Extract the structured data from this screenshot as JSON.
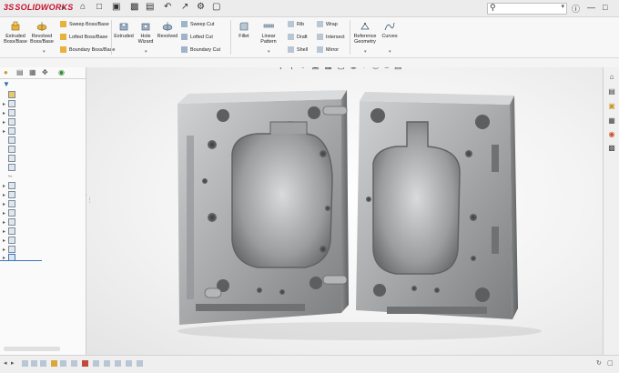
{
  "app": {
    "brand": "SOLIDWORKS",
    "brand_prefix": "3S"
  },
  "search": {
    "placeholder": ""
  },
  "ribbon": {
    "commands": [
      {
        "id": "extruded-boss",
        "label_line1": "Extruded",
        "label_line2": "Boss/Base"
      },
      {
        "id": "revolved-boss",
        "label_line1": "Revolved",
        "label_line2": "Boss/Base"
      },
      {
        "id": "sweep-boss",
        "label": "Sweep Boss/Base"
      },
      {
        "id": "lofted-boss",
        "label": "Lofted Boss/Base"
      },
      {
        "id": "boundary-boss",
        "label": "Boundary Boss/Base"
      },
      {
        "id": "extruded-cut",
        "label_line1": "Extruded",
        "label_line2": ""
      },
      {
        "id": "hole-wizard",
        "label_line1": "Hole",
        "label_line2": "Wizard"
      },
      {
        "id": "revolved-cut",
        "label_line1": "Revolved",
        "label_line2": ""
      },
      {
        "id": "swept-cut",
        "label": "Sweep Cut"
      },
      {
        "id": "lofted-cut",
        "label": "Lofted Cut"
      },
      {
        "id": "boundary-cut",
        "label": "Boundary Cut"
      },
      {
        "id": "fillet",
        "label_line1": "Fillet",
        "label_line2": ""
      },
      {
        "id": "linear-pattern",
        "label_line1": "Linear",
        "label_line2": "Pattern"
      },
      {
        "id": "rib",
        "label": "Rib"
      },
      {
        "id": "draft",
        "label": "Draft"
      },
      {
        "id": "shell",
        "label": "Shell"
      },
      {
        "id": "wrap",
        "label": "Wrap"
      },
      {
        "id": "intersect",
        "label": "Intersect"
      },
      {
        "id": "mirror",
        "label": "Mirror"
      },
      {
        "id": "reference-geometry",
        "label_line1": "Reference",
        "label_line2": "Geometry"
      },
      {
        "id": "curves",
        "label_line1": "Curves",
        "label_line2": ""
      }
    ]
  },
  "colors": {
    "brand_red": "#c8102e",
    "accent_blue": "#3a78c0",
    "mold_steel": "#a8aaad"
  }
}
